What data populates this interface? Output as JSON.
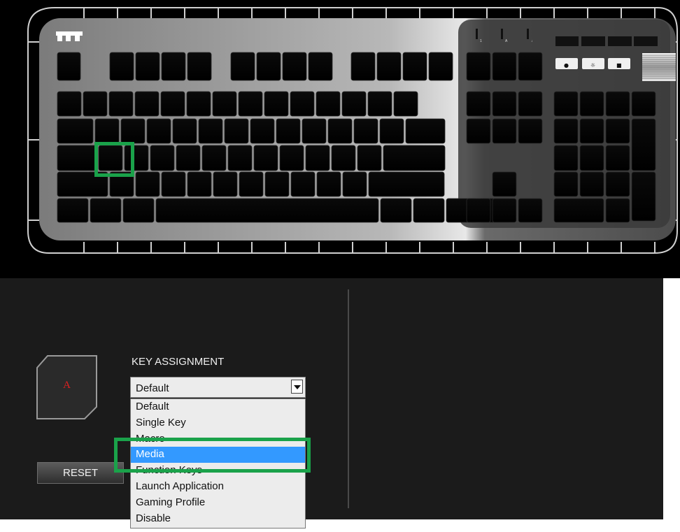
{
  "keyboard": {
    "brand": "Thermaltake",
    "led_labels": [
      "1",
      "A",
      "↓"
    ],
    "media_icons": [
      "●",
      "☼",
      "■"
    ]
  },
  "editor": {
    "key_preview_label": "A",
    "assignment_title": "KEY ASSIGNMENT",
    "selected_value": "Default",
    "options": [
      "Default",
      "Single Key",
      "Macro",
      "Media",
      "Function Keys",
      "Launch Application",
      "Gaming Profile",
      "Disable"
    ],
    "highlighted_option": "Media",
    "reset_label": "RESET"
  },
  "colors": {
    "highlight": "#1aa24a",
    "selection": "#3399ff",
    "key_label": "#e02020"
  }
}
